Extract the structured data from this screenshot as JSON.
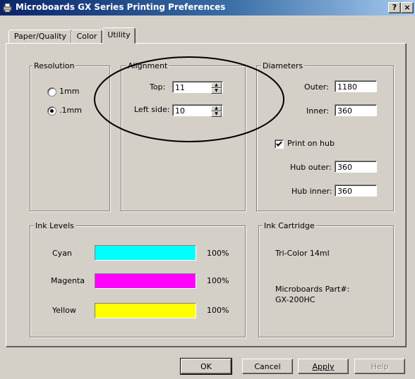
{
  "window": {
    "title": "Microboards GX Series Printing Preferences",
    "help_button": "?",
    "close_button": "×"
  },
  "tabs": [
    {
      "label": "Paper/Quality"
    },
    {
      "label": "Color"
    },
    {
      "label": "Utility"
    }
  ],
  "resolution": {
    "legend": "Resolution",
    "options": [
      {
        "label": "1mm",
        "selected": false
      },
      {
        "label": ".1mm",
        "selected": true
      }
    ]
  },
  "alignment": {
    "legend": "Alignment",
    "top_label": "Top:",
    "top_value": "11",
    "left_label": "Left side:",
    "left_value": "10"
  },
  "diameters": {
    "legend": "Diameters",
    "outer_label": "Outer:",
    "outer_value": "1180",
    "inner_label": "Inner:",
    "inner_value": "360",
    "print_on_hub_label": "Print on hub",
    "print_on_hub_checked": true,
    "hub_outer_label": "Hub outer:",
    "hub_outer_value": "360",
    "hub_inner_label": "Hub inner:",
    "hub_inner_value": "360"
  },
  "ink_levels": {
    "legend": "Ink Levels",
    "items": [
      {
        "name": "Cyan",
        "percent_label": "100%",
        "level": 1.0,
        "color": "#00ffff"
      },
      {
        "name": "Magenta",
        "percent_label": "100%",
        "level": 1.0,
        "color": "#ff00ff"
      },
      {
        "name": "Yellow",
        "percent_label": "100%",
        "level": 1.0,
        "color": "#ffff00"
      }
    ]
  },
  "ink_cartridge": {
    "legend": "Ink Cartridge",
    "type": "Tri-Color 14ml",
    "part_label": "Microboards Part#:",
    "part_number": "GX-200HC"
  },
  "buttons": {
    "ok": "OK",
    "cancel": "Cancel",
    "apply": "Apply",
    "help": "Help"
  },
  "colors": {
    "title_gradient_start": "#0a246a",
    "dialog_bg": "#d4d0c8",
    "annotation_ellipse": "#000000"
  }
}
